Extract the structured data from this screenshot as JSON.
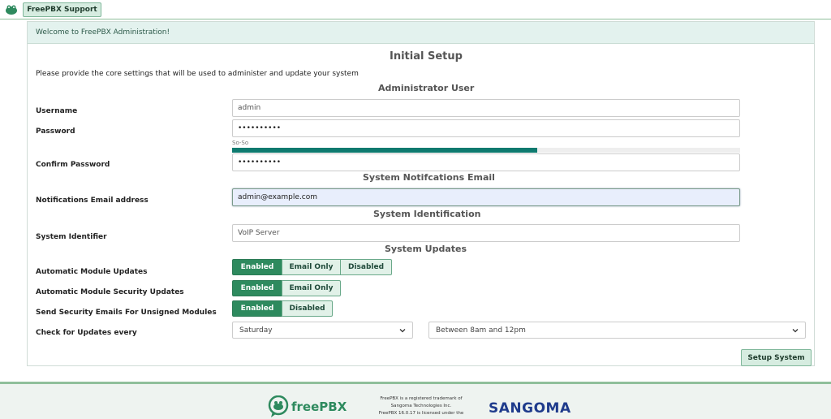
{
  "header": {
    "support_label": "FreePBX Support"
  },
  "panel": {
    "welcome": "Welcome to FreePBX Administration!"
  },
  "form": {
    "title": "Initial Setup",
    "description": "Please provide the core settings that will be used to administer and update your system",
    "admin_section": "Administrator User",
    "username_label": "Username",
    "username_value": "admin",
    "password_label": "Password",
    "password_value": "••••••••••",
    "strength_text": "So-So",
    "strength_fraction": 0.6,
    "confirm_label": "Confirm Password",
    "confirm_value": "••••••••••",
    "email_section": "System Notifcations Email",
    "email_label": "Notifications Email address",
    "email_value": "admin@example.com",
    "ident_section": "System Identification",
    "ident_label": "System Identifier",
    "ident_value": "VoIP Server",
    "updates_section": "System Updates",
    "auto_updates_label": "Automatic Module Updates",
    "auto_updates_options": [
      "Enabled",
      "Email Only",
      "Disabled"
    ],
    "security_updates_label": "Automatic Module Security Updates",
    "security_updates_options": [
      "Enabled",
      "Email Only"
    ],
    "unsigned_label": "Send Security Emails For Unsigned Modules",
    "unsigned_options": [
      "Enabled",
      "Disabled"
    ],
    "check_label": "Check for Updates every",
    "day_value": "Saturday",
    "time_value": "Between 8am and 12pm",
    "setup_button": "Setup System"
  },
  "footer": {
    "freepbx_logo": "freePBX",
    "trademark_lines": [
      "FreePBX is a registered trademark of",
      "Sangoma Technologies Inc.",
      "FreePBX 16.0.17 is licensed under the"
    ],
    "sangoma_logo": "SANGOMA"
  },
  "colors": {
    "accent": "#2e8a5e",
    "strength": "#0e7a6f",
    "panel_header": "#e3f2ee"
  }
}
